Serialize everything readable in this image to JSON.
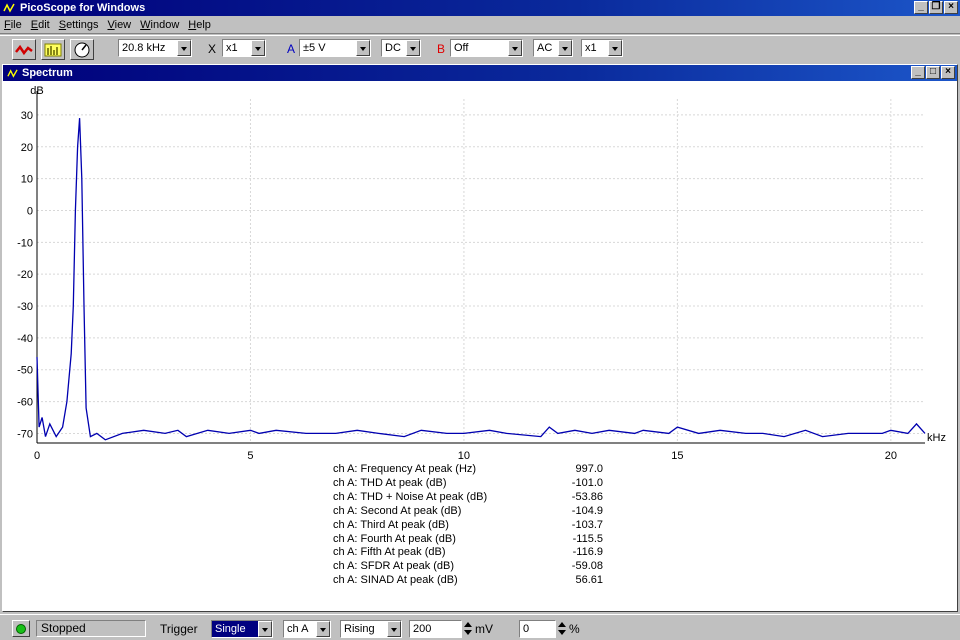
{
  "app": {
    "title": "PicoScope for Windows"
  },
  "menu": [
    "File",
    "Edit",
    "Settings",
    "View",
    "Window",
    "Help"
  ],
  "toolbar": {
    "timebase": "20.8 kHz",
    "x_mult_label": "X",
    "x_mult": "x1",
    "chA_label": "A",
    "chA_range": "±5 V",
    "chA_coupling": "DC",
    "chB_label": "B",
    "chB_range": "Off",
    "chB_coupling": "AC",
    "chB_mult": "x1"
  },
  "colors": {
    "trace": "#0000b0",
    "channelA": "#0000c0",
    "channelB": "#e00000",
    "titlebar": "#00007b"
  },
  "spectrum_window": {
    "title": "Spectrum"
  },
  "chart_data": {
    "type": "line",
    "ylabel": "dB",
    "xlabel": "kHz",
    "ylim": [
      -73,
      35
    ],
    "xlim": [
      0,
      20.8
    ],
    "yticks": [
      30,
      20,
      10,
      0,
      -10,
      -20,
      -30,
      -40,
      -50,
      -60,
      -70
    ],
    "xticks": [
      0,
      5,
      10,
      15,
      20
    ],
    "grid": true,
    "series": [
      {
        "values_x": [
          0,
          0.05,
          0.12,
          0.2,
          0.3,
          0.45,
          0.6,
          0.7,
          0.8,
          0.85,
          0.9,
          0.95,
          0.997,
          1.05,
          1.1,
          1.15,
          1.25,
          1.4,
          1.6,
          2.0,
          2.5,
          3.0,
          3.3,
          3.5,
          4.0,
          4.5,
          5.0,
          5.2,
          5.6,
          6.3,
          7.0,
          7.5,
          8.0,
          8.6,
          9.0,
          9.6,
          10.0,
          10.6,
          11.0,
          11.8,
          12.0,
          12.2,
          12.6,
          13.0,
          13.4,
          14.0,
          14.2,
          14.8,
          15.0,
          15.5,
          16.0,
          16.6,
          17.0,
          17.5,
          18.0,
          18.4,
          19.0,
          19.8,
          20.0,
          20.4,
          20.6,
          20.8
        ],
        "values_y": [
          -46,
          -68,
          -65,
          -71,
          -67,
          -71,
          -68,
          -60,
          -45,
          -30,
          0,
          20,
          29,
          10,
          -30,
          -62,
          -71,
          -70,
          -72,
          -70,
          -69,
          -70,
          -69,
          -71,
          -69,
          -70,
          -69,
          -70,
          -69,
          -70,
          -70,
          -69,
          -70,
          -71,
          -69,
          -70,
          -70,
          -69,
          -70,
          -71,
          -68,
          -70,
          -69,
          -70,
          -69,
          -70,
          -69,
          -70,
          -68,
          -70,
          -69,
          -70,
          -70,
          -71,
          -69,
          -71,
          -70,
          -70,
          -69,
          -70,
          -67,
          -70
        ]
      }
    ]
  },
  "measurements": [
    {
      "label": "ch A: Frequency At peak (Hz)",
      "value": "997.0"
    },
    {
      "label": "ch A: THD At peak (dB)",
      "value": "-101.0"
    },
    {
      "label": "ch A: THD + Noise At peak (dB)",
      "value": "-53.86"
    },
    {
      "label": "ch A: Second At peak (dB)",
      "value": "-104.9"
    },
    {
      "label": "ch A: Third At peak (dB)",
      "value": "-103.7"
    },
    {
      "label": "ch A: Fourth At peak (dB)",
      "value": "-115.5"
    },
    {
      "label": "ch A: Fifth At peak (dB)",
      "value": "-116.9"
    },
    {
      "label": "ch A: SFDR At peak (dB)",
      "value": "-59.08"
    },
    {
      "label": "ch A: SINAD At peak (dB)",
      "value": "56.61"
    }
  ],
  "statusbar": {
    "status": "Stopped",
    "trigger_label": "Trigger",
    "trigger_mode": "Single",
    "trigger_channel": "ch A",
    "trigger_edge": "Rising",
    "threshold": "200",
    "threshold_unit": "mV",
    "delay": "0",
    "delay_unit": "%"
  }
}
